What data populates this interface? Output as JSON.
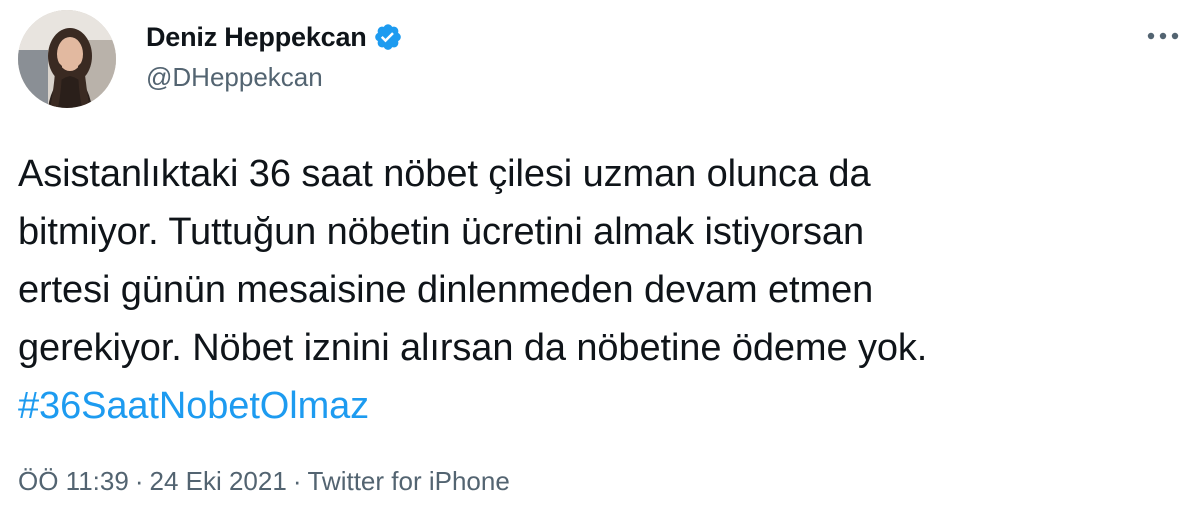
{
  "tweet": {
    "author": {
      "display_name": "Deniz Heppekcan",
      "handle": "@DHeppekcan",
      "verified": true,
      "verified_color": "#1d9bf0"
    },
    "more_icon": "more-horizontal-icon",
    "body_lines": [
      "Asistanlıktaki 36 saat nöbet çilesi uzman olunca da",
      "bitmiyor. Tuttuğun nöbetin ücretini almak istiyorsan",
      "ertesi günün mesaisine dinlenmeden devam etmen",
      "gerekiyor. Nöbet iznini alırsan da nöbetine ödeme yok."
    ],
    "hashtag": "#36SaatNobetOlmaz",
    "hashtag_color": "#1d9bf0",
    "meta": {
      "time": "ÖÖ 11:39",
      "separator": "·",
      "date": "24 Eki 2021",
      "source": "Twitter for iPhone"
    }
  }
}
